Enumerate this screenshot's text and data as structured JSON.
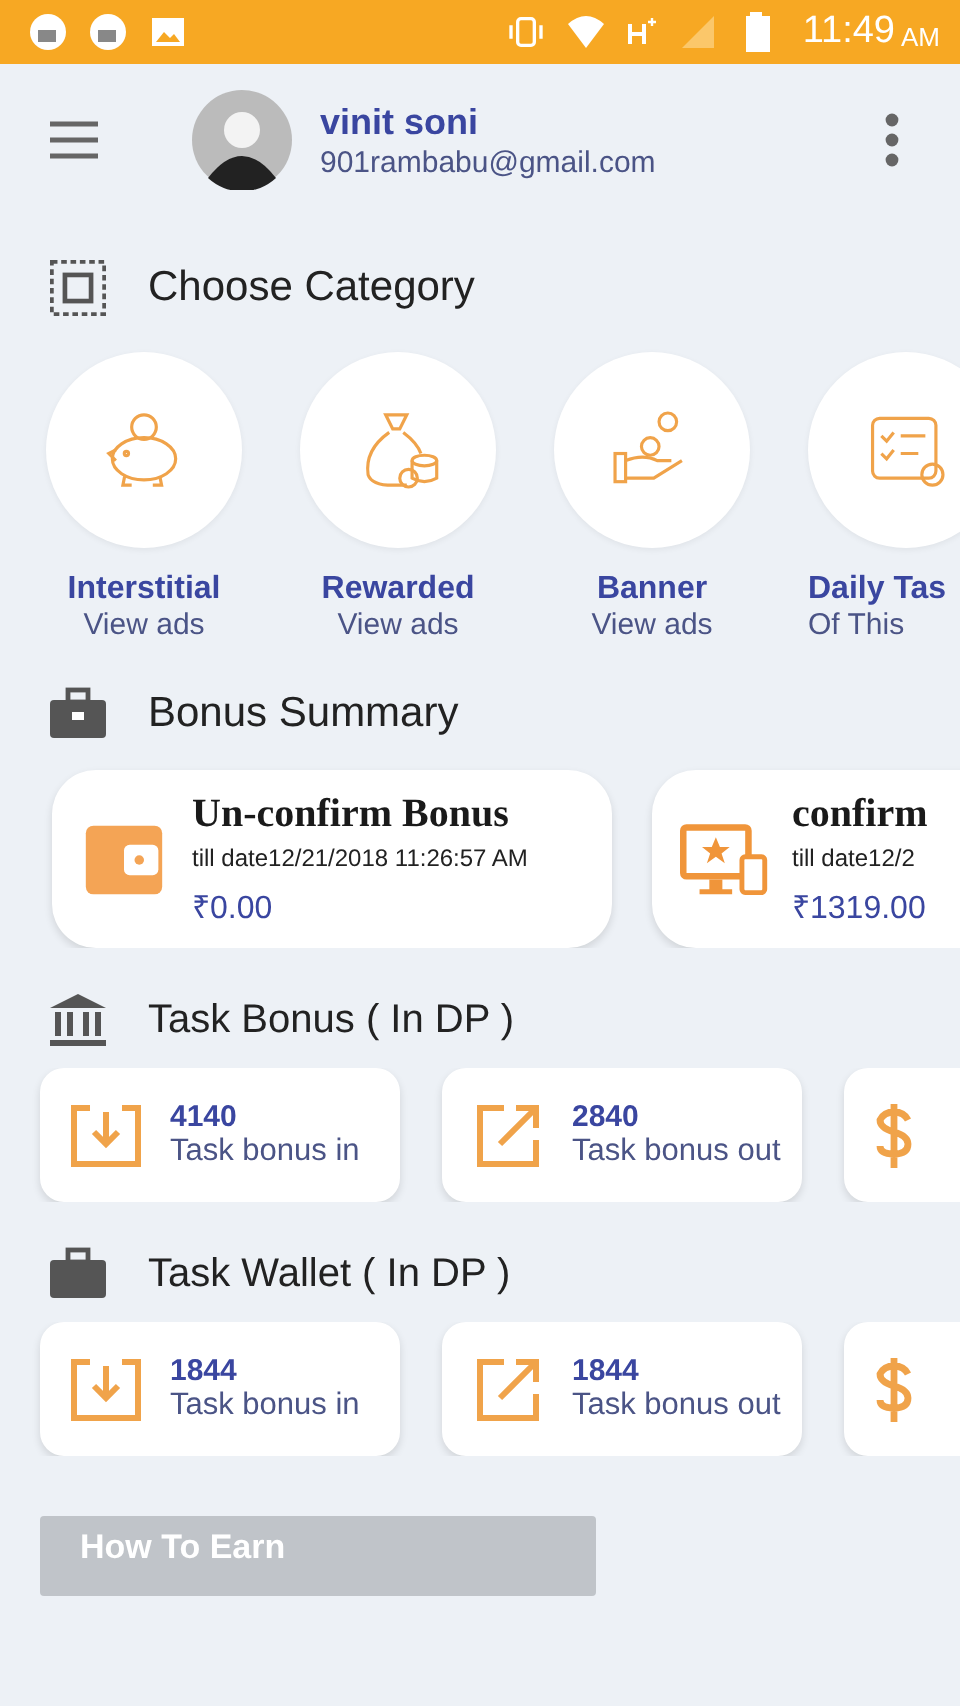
{
  "status_bar": {
    "time": "11:49",
    "meridiem": "AM"
  },
  "header": {
    "name": "vinit soni",
    "email": "901rambabu@gmail.com"
  },
  "category": {
    "title": "Choose Category",
    "items": [
      {
        "kind": "piggy",
        "title": "Interstitial",
        "subtitle": "View ads"
      },
      {
        "kind": "moneybag",
        "title": "Rewarded",
        "subtitle": "View ads"
      },
      {
        "kind": "coin-hand",
        "title": "Banner",
        "subtitle": "View ads"
      },
      {
        "kind": "checklist",
        "title": "Daily Tas",
        "subtitle": "Of This"
      }
    ]
  },
  "bonus_summary": {
    "title": "Bonus Summary",
    "cards": [
      {
        "kind": "wallet",
        "title": "Un-confirm Bonus",
        "date": "till date12/21/2018 11:26:57 AM",
        "amount": "₹0.00"
      },
      {
        "kind": "monitor",
        "title": "confirm",
        "date": "till date12/2",
        "amount": "₹1319.00"
      }
    ]
  },
  "task_bonus": {
    "title": "Task Bonus ( In DP )",
    "cards": [
      {
        "kind": "in",
        "value": "4140",
        "label": "Task bonus in"
      },
      {
        "kind": "out",
        "value": "2840",
        "label": "Task bonus out"
      },
      {
        "kind": "money"
      }
    ]
  },
  "task_wallet": {
    "title": "Task Wallet ( In DP )",
    "cards": [
      {
        "kind": "in",
        "value": "1844",
        "label": "Task bonus in"
      },
      {
        "kind": "out",
        "value": "1844",
        "label": "Task bonus out"
      },
      {
        "kind": "money"
      }
    ]
  },
  "how_to_earn": {
    "label": "How To Earn"
  }
}
